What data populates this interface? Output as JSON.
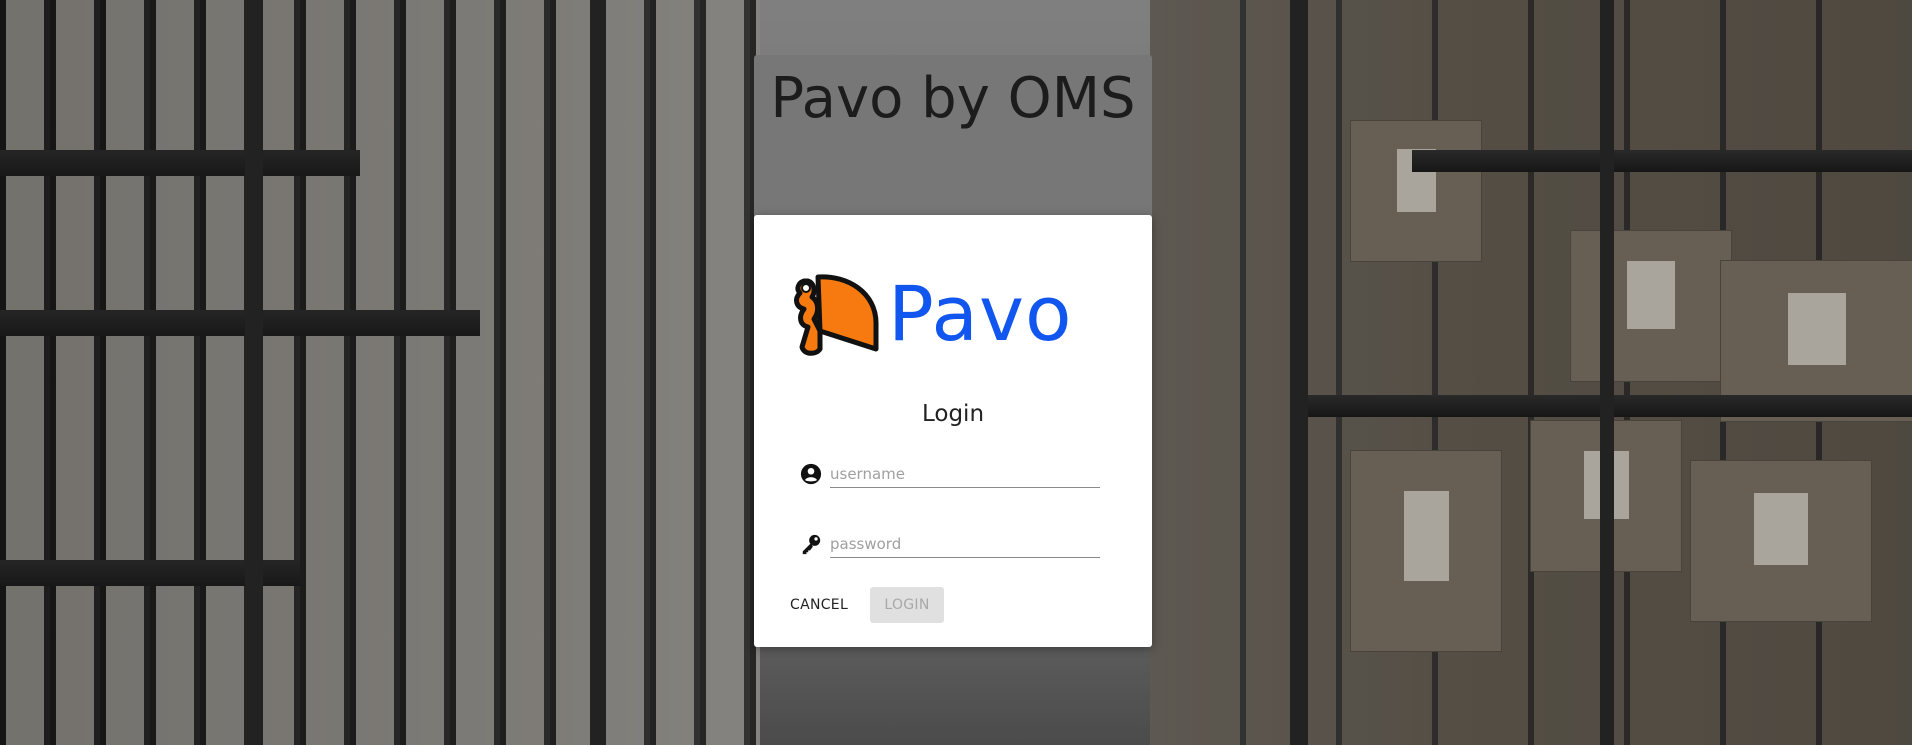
{
  "app": {
    "title": "Pavo by OMS"
  },
  "logo": {
    "wordmark": "Pavo",
    "mark_icon": "pavo-bird-logo-icon",
    "colors": {
      "wordmark": "#1256f0",
      "mark_fill": "#f77a10",
      "mark_outline": "#111111"
    }
  },
  "login": {
    "heading": "Login",
    "username": {
      "icon": "account-circle-icon",
      "placeholder": "username",
      "value": ""
    },
    "password": {
      "icon": "key-icon",
      "placeholder": "password",
      "value": ""
    },
    "buttons": {
      "cancel_label": "CANCEL",
      "login_label": "LOGIN"
    }
  },
  "theme": {
    "title_panel_bg": "#777777",
    "card_bg": "#ffffff",
    "login_disabled_bg": "#e0e0e0"
  }
}
